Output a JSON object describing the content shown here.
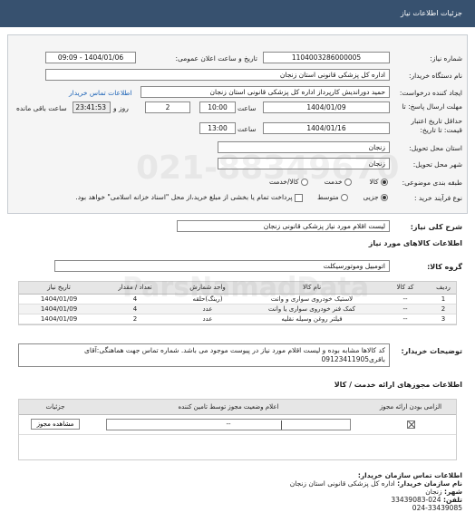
{
  "header": {
    "title": "جزئیات اطلاعات نیاز"
  },
  "form": {
    "need_number_label": "شماره نیاز:",
    "need_number": "1104003286000005",
    "announce_label": "تاریخ و ساعت اعلان عمومی:",
    "announce_value": "1404/01/06 - 09:09",
    "buyer_label": "نام دستگاه خریدار:",
    "buyer_value": "اداره کل پزشکی قانونی استان زنجان",
    "requester_label": "ایجاد کننده درخواست:",
    "requester_value": "حمید دوراندیش کارپرداز اداره کل پزشکی قانونی استان زنجان",
    "contact_link": "اطلاعات تماس خریدار",
    "reply_deadline_label": "مهلت ارسال پاسخ: تا",
    "reply_date": "1404/01/09",
    "time_label": "ساعت",
    "reply_time": "10:00",
    "days_value": "2",
    "days_label": "روز و",
    "remaining_time": "23:41:53",
    "remaining_label": "ساعت باقی مانده",
    "validity_label_1": "حداقل تاریخ اعتبار",
    "validity_label_2": "قیمت: تا تاریخ:",
    "validity_date": "1404/01/16",
    "validity_time_label": "ساعت",
    "validity_time": "13:00",
    "province_label": "استان محل تحویل:",
    "province_value": "زنجان",
    "city_label": "شهر محل تحویل:",
    "city_value": "زنجان",
    "category_label": "طبقه بندی موضوعی:",
    "category_options": [
      "کالا",
      "خدمت",
      "کالا/خدمت"
    ],
    "process_label": "نوع فرآیند خرید :",
    "process_options": [
      "جزیی",
      "متوسط"
    ],
    "payment_note": "پرداخت تمام یا بخشی از مبلغ خرید،از محل \"اسناد خزانه اسلامی\" خواهد بود."
  },
  "summary": {
    "label": "شرح کلی نیاز:",
    "value": "لیست اقلام مورد نیاز پزشکی قانونی زنجان"
  },
  "goods": {
    "section_title": "اطلاعات کالاهای مورد نیاز",
    "group_label": "گروه کالا:",
    "group_value": "اتومبیل وموتورسیکلت",
    "columns": [
      "ردیف",
      "کد کالا",
      "نام کالا",
      "واحد شمارش",
      "تعداد / مقدار",
      "تاریخ نیاز"
    ],
    "rows": [
      [
        "1",
        "--",
        "لاستیک خودروی سواری و وانت",
        "(رینگ)حلقه",
        "4",
        "1404/01/09"
      ],
      [
        "2",
        "--",
        "کمک فنر خودروی سواری یا وانت",
        "عدد",
        "4",
        "1404/01/09"
      ],
      [
        "3",
        "--",
        "فیلتر روغن وسیله نقلیه",
        "عدد",
        "2",
        "1404/01/09"
      ]
    ]
  },
  "notes": {
    "label": "توضیحات خریدار:",
    "value": "کد کالاها مشابه بوده و لیست اقلام مورد نیاز در پیوست موجود می باشد. شماره تماس جهت هماهنگی:آقای باقری09123411905"
  },
  "licenses": {
    "title": "اطلاعات مجوزهای ارائه خدمت / کالا",
    "columns": [
      "الزامی بودن ارائه مجوز",
      "اعلام وضعیت مجوز توسط تامین کننده",
      "جزئیات"
    ],
    "status_value": "--",
    "view_button": "مشاهده مجوز"
  },
  "contact": {
    "title": "اطلاعات تماس سازمان خریدار:",
    "org_label": "نام سازمان خریدار:",
    "org_value": "اداره کل پزشکی قانونی استان زنجان",
    "city_label": "شهر:",
    "city_value": "زنجان",
    "phone_label": "تلفن:",
    "phone_value": "024-33439083",
    "fax_value": "024-33439085"
  },
  "watermark": {
    "phone": "021-88349670",
    "site": "ParsNamadData"
  }
}
